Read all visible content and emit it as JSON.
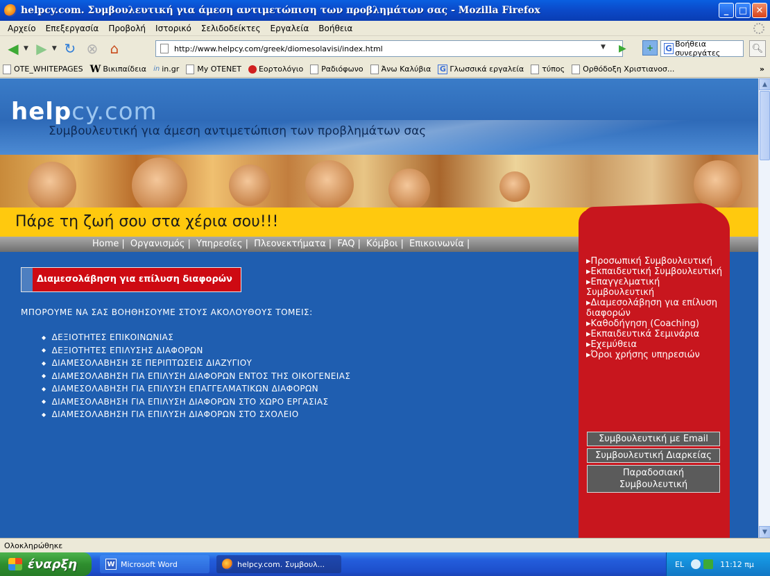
{
  "window": {
    "title": "helpcy.com. Συμβουλευτική για άμεση αντιμετώπιση των προβλημάτων σας - Mozilla Firefox"
  },
  "menu": [
    "Αρχείο",
    "Επεξεργασία",
    "Προβολή",
    "Ιστορικό",
    "Σελιδοδείκτες",
    "Εργαλεία",
    "Βοήθεια"
  ],
  "navbar": {
    "url": "http://www.helpcy.com/greek/diomesolavisi/index.html",
    "search_placeholder": "Βοήθεια συνεργάτες"
  },
  "bookmarks": [
    {
      "label": "OTE_WHITEPAGES",
      "icon": "page-icon"
    },
    {
      "label": "Βικιπαίδεια",
      "icon": "wikipedia-icon"
    },
    {
      "label": "in.gr",
      "icon": "in-icon"
    },
    {
      "label": "My OTENET",
      "icon": "page-icon"
    },
    {
      "label": "Εορτολόγιο",
      "icon": "flower-icon"
    },
    {
      "label": "Ραδιόφωνο",
      "icon": "page-icon"
    },
    {
      "label": "Άνω Καλύβια",
      "icon": "page-icon"
    },
    {
      "label": "Γλωσσικά εργαλεία",
      "icon": "google-icon"
    },
    {
      "label": "τύπος",
      "icon": "page-icon"
    },
    {
      "label": "Ορθόδοξη Χριστιανοσ...",
      "icon": "page-icon"
    }
  ],
  "site": {
    "logo_main": "help",
    "logo_cy": "cy",
    "logo_dotcom": ".com",
    "tagline": "Συμβουλευτική για άμεση αντιμετώπιση των προβλημάτων σας",
    "slogan": "Πάρε τη ζωή σου στα χέρια σου!!!",
    "nav": [
      "Home",
      "Οργανισμός",
      "Υπηρεσίες",
      "Πλεονεκτήματα",
      "FAQ",
      "Κόμβοι",
      "Επικοινωνία"
    ],
    "section_title": "Διαμεσολάβηση για επίλυση διαφορών",
    "intro": "ΜΠΟΡΟΥΜΕ ΝΑ ΣΑΣ ΒΟΗΘΗΣΟΥΜΕ ΣΤΟΥΣ ΑΚΟΛΟΥΘΟΥΣ ΤΟΜΕΙΣ:",
    "areas": [
      "ΔΕΞΙΟΤΗΤΕΣ ΕΠΙΚΟΙΝΩΝΙΑΣ",
      "ΔΕΞΙΟΤΗΤΕΣ ΕΠΙΛΥΣΗΣ ΔΙΑΦΟΡΩΝ",
      "ΔΙΑΜΕΣΟΛΑΒΗΣΗ ΣΕ ΠΕΡΙΠΤΩΣΕΙΣ ΔΙΑΖΥΓΙΟΥ",
      "ΔΙΑΜΕΣΟΛΑΒΗΣΗ ΓΙΑ ΕΠΙΛΥΣΗ ΔΙΑΦΟΡΩΝ ΕΝΤΟΣ ΤΗΣ ΟΙΚΟΓΕΝΕΙΑΣ",
      "ΔΙΑΜΕΣΟΛΑΒΗΣΗ ΓΙΑ ΕΠΙΛΥΣΗ ΕΠΑΓΓΕΛΜΑΤΙΚΩΝ ΔΙΑΦΟΡΩΝ",
      "ΔΙΑΜΕΣΟΛΑΒΗΣΗ ΓΙΑ ΕΠΙΛΥΣΗ ΔΙΑΦΟΡΩΝ ΣΤΟ ΧΩΡΟ ΕΡΓΑΣΙΑΣ",
      "ΔΙΑΜΕΣΟΛΑΒΗΣΗ ΓΙΑ ΕΠΙΛΥΣΗ ΔΙΑΦΟΡΩΝ ΣΤΟ ΣΧΟΛΕΙΟ"
    ],
    "side_links": [
      "▸Προσωπική Συμβουλευτική",
      "▸Εκπαιδευτική Συμβουλευτική",
      "▸Επαγγελματική Συμβουλευτική",
      "▸Διαμεσολάβηση για επίλυση διαφορών",
      "▸Καθοδήγηση (Coaching)",
      "▸Εκπαιδευτικά Σεμινάρια",
      "▸Εχεμύθεια",
      "▸Όροι χρήσης υπηρεσιών"
    ],
    "buttons": [
      "Συμβουλευτική με Email",
      "Συμβουλευτική Διαρκείας",
      "Παραδοσιακή Συμβουλευτική"
    ]
  },
  "status": "Ολοκληρώθηκε",
  "taskbar": {
    "start": "έναρξη",
    "tasks": [
      "Microsoft Word",
      "helpcy.com. Συμβουλ..."
    ],
    "lang": "EL",
    "clock": "11:12 πμ"
  },
  "colors": {
    "page_blue": "#1F5EB0",
    "slogan_yellow": "#FFC90E",
    "side_red": "#C8161E",
    "title_red": "#CE0A12"
  }
}
